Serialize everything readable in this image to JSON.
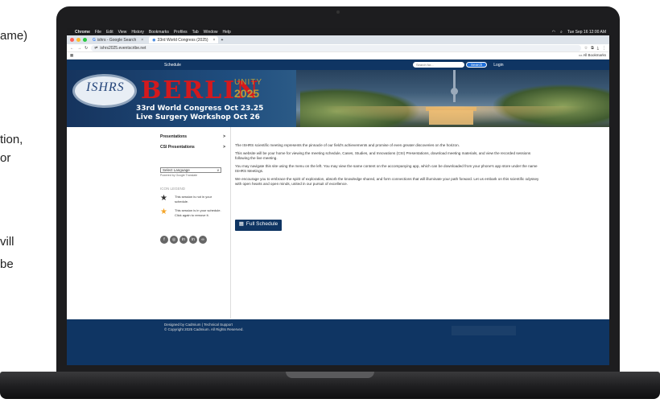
{
  "side_text": {
    "line1": "ame)",
    "line2": "tion,",
    "line3": "or",
    "line4": "vill",
    "line5": "be"
  },
  "menubar": {
    "apple": "",
    "items": [
      "Chrome",
      "File",
      "Edit",
      "View",
      "History",
      "Bookmarks",
      "Profiles",
      "Tab",
      "Window",
      "Help"
    ],
    "datetime": "Tue Sep 16 12:00 AM"
  },
  "browser": {
    "tabs": [
      {
        "label": "ishrs - Google Search"
      },
      {
        "label": "33rd World Congress (2025)"
      }
    ],
    "new_tab": "+",
    "close": "×",
    "url": "ishrs2025.eventscribe.net",
    "all_bookmarks": "All Bookmarks"
  },
  "site_nav": {
    "schedule": "Schedule",
    "search_placeholder": "Search for...",
    "search_button": "Search",
    "login": "Login"
  },
  "banner": {
    "logo": "ISHRS",
    "berlin": "BERLIN",
    "unity": "UNITY",
    "year": "2025",
    "line1": "33rd World Congress Oct 23.25",
    "line2": "Live Surgery Workshop Oct 26"
  },
  "sidebar": {
    "links": [
      {
        "label": "Presentations",
        "chevron": ">"
      },
      {
        "label": "CSI Presentations",
        "chevron": ">"
      }
    ],
    "language": "Select Language",
    "language_arrow": "v",
    "powered": "Powered by Google Translate",
    "legend_title": "ICON LEGEND",
    "legend": [
      {
        "text": "This session is not in your schedule.",
        "color": "#333333"
      },
      {
        "text": "This session is in your schedule. Click again to remove it.",
        "color": "#f4a62a"
      }
    ],
    "socials": [
      "f",
      "◎",
      "in",
      "in",
      "∞"
    ]
  },
  "main": {
    "paragraphs": [
      "The ISHRS scientific meeting represents the pinnacle of our field's achievements and promise of even greater discoveries on the horizon.",
      "This website will be your home for viewing the meeting schedule, Cases, Studies, and Innovations (CSI) Presentations, download meeting materials, and view the recorded sessions following the live meeting.",
      "You may navigate this site using the menu on the left. You may view the same content on the accompanying app, which can be downloaded from your phone's app store under the name ISHRS Meetings.",
      "We encourage you to embrace the spirit of exploration, absorb the knowledge shared, and form connections that will illuminate your path forward. Let us embark on this scientific odyssey with open hearts and open minds, united in our pursuit of excellence."
    ],
    "full_schedule": "Full Schedule"
  },
  "footer": {
    "line1": "Designed by Cadmium  |  Technical Support",
    "line2": "© Copyright 2025 Cadmium. All Rights Reserved."
  }
}
